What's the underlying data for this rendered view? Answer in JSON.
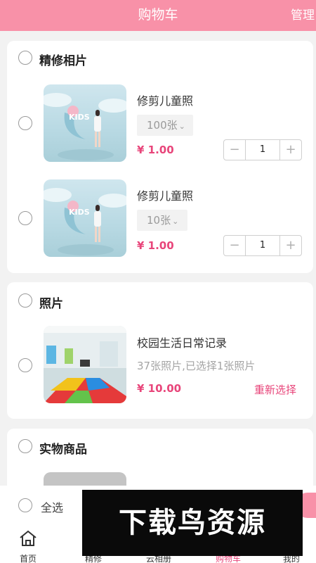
{
  "header": {
    "title": "购物车",
    "manage": "管理"
  },
  "sections": [
    {
      "title": "精修相片",
      "items": [
        {
          "title": "修剪儿童照",
          "spec": "100张",
          "price": "¥ 1.00",
          "qty": "1",
          "thumb_text": "KIDS"
        },
        {
          "title": "修剪儿童照",
          "spec": "10张",
          "price": "¥ 1.00",
          "qty": "1",
          "thumb_text": "KIDS"
        }
      ]
    },
    {
      "title": "照片",
      "items": [
        {
          "title": "校园生活日常记录",
          "subtitle": "37张照片,已选择1张照片",
          "price": "¥ 10.00",
          "action": "重新选择"
        }
      ]
    },
    {
      "title": "实物商品"
    }
  ],
  "bottom": {
    "select_all": "全选",
    "tabs": [
      "首页",
      "精修",
      "云相册",
      "购物车",
      "我的"
    ],
    "active_tab": "购物车"
  },
  "watermark": "下载鸟资源",
  "colors": {
    "accent": "#f891a8",
    "price": "#e8457a"
  }
}
